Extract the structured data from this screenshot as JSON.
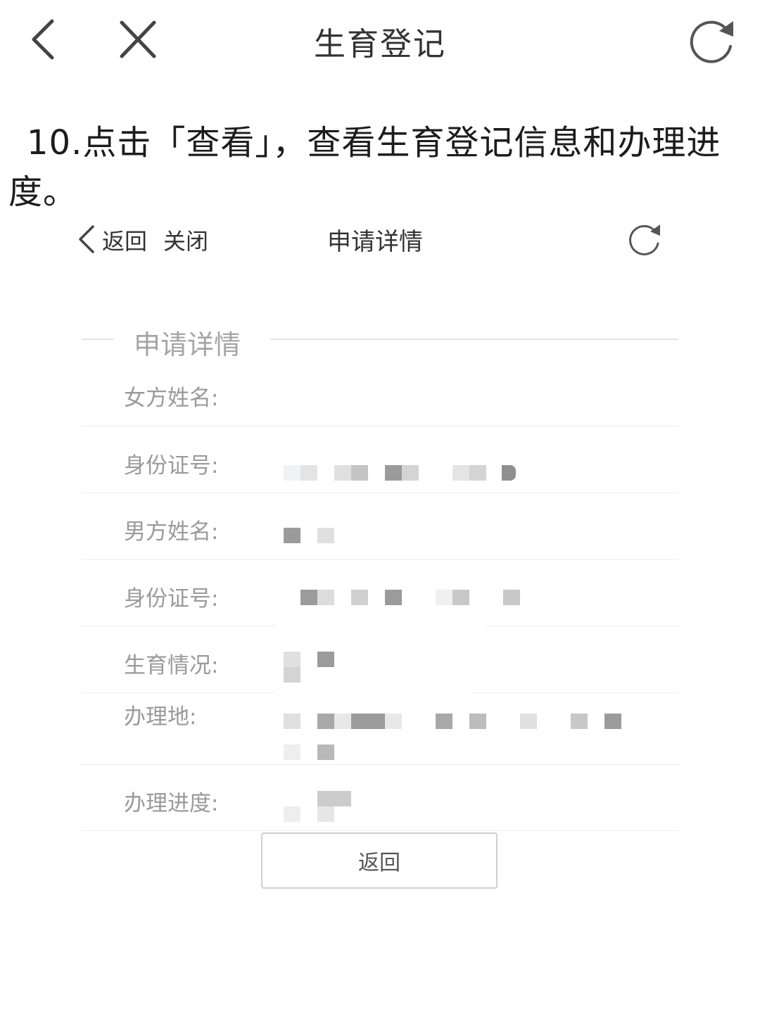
{
  "app_bar": {
    "title": "生育登记",
    "icons": [
      "chevron-left-icon",
      "close-icon",
      "refresh-icon"
    ]
  },
  "instruction": {
    "text": "10.点击「查看」，查看生育登记信息和办理进度。"
  },
  "inner_screen": {
    "back_label": "返回",
    "close_label": "关闭",
    "title": "申请详情",
    "section_title": "申请详情",
    "fields": [
      {
        "label": "女方姓名:"
      },
      {
        "label": "身份证号:"
      },
      {
        "label": "男方姓名:"
      },
      {
        "label": "身份证号:"
      },
      {
        "label": "生育情况:"
      },
      {
        "label": "办理地:"
      },
      {
        "label": "办理进度:"
      }
    ],
    "return_button_label": "返回"
  },
  "colors": {
    "text_primary": "#333333",
    "label_gray": "#9a9a9a",
    "section_title_gray": "#a5a5a5",
    "divider": "#ececec",
    "pixel_dark": "#9b9b9b",
    "pixel_mid": "#c4c4c4",
    "pixel_light": "#e4e4e4"
  }
}
